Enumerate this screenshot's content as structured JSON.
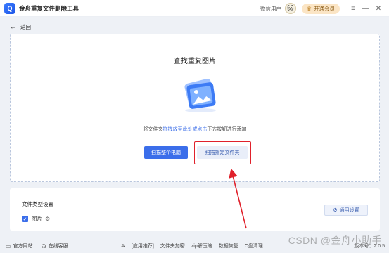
{
  "app": {
    "logo_text": "Q",
    "title": "金舟重复文件删除工具"
  },
  "titlebar": {
    "user": "微信用户",
    "vip_label": "开通会员",
    "window_buttons": [
      "≡",
      "—",
      "✕"
    ]
  },
  "nav": {
    "back_label": "返回"
  },
  "main": {
    "title": "查找重复图片",
    "hint_prefix": "将文件夹",
    "hint_link": "拖拽放至此处或点击",
    "hint_suffix": "下方按钮进行添加",
    "scan_all_label": "扫描整个电脑",
    "scan_folder_label": "扫描指定文件夹"
  },
  "settings": {
    "title": "文件类型设置",
    "type_label": "图片",
    "apply_label": "通用设置"
  },
  "footer": {
    "website": "官方网站",
    "service": "在线客服",
    "recommend": "[应用推荐]",
    "links": [
      "文件夹加密",
      "zip解压缩",
      "数据恢复",
      "C盘清理"
    ],
    "version_label": "版本号：",
    "version_value": "2.0.5"
  },
  "watermark": "CSDN @金舟小助手",
  "colors": {
    "accent": "#3b6eea",
    "highlight": "#e0212b"
  }
}
